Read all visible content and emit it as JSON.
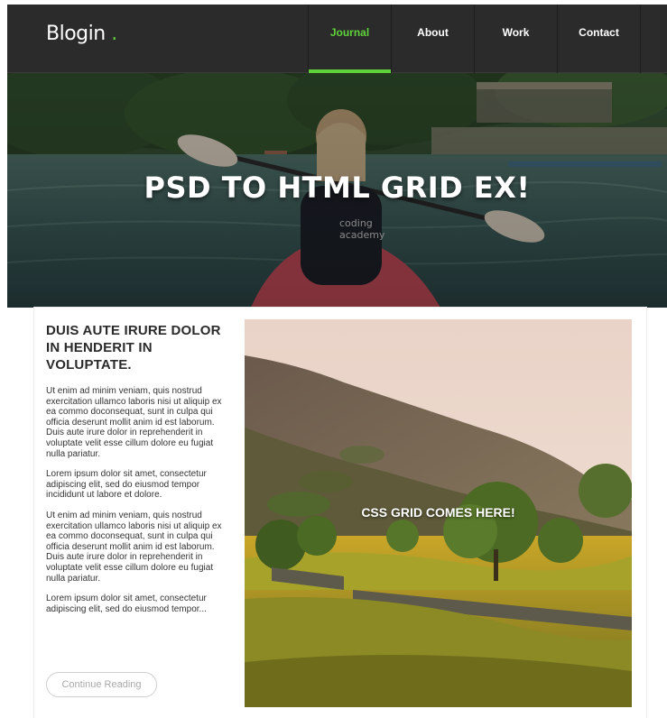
{
  "header": {
    "logo_text": "Blogin",
    "logo_dot": ".",
    "nav": [
      {
        "label": "Journal",
        "active": true
      },
      {
        "label": "About",
        "active": false
      },
      {
        "label": "Work",
        "active": false
      },
      {
        "label": "Contact",
        "active": false
      }
    ]
  },
  "hero": {
    "title": "PSD TO HTML GRID EX!",
    "shirt_text": [
      "coding",
      "academy"
    ]
  },
  "article": {
    "title": "DUIS AUTE IRURE DOLOR IN HENDERIT IN VOLUPTATE.",
    "paragraphs": [
      "Ut enim ad minim veniam, quis nostrud exercitation ullamco laboris nisi ut aliquip ex ea commo doconsequat, sunt in culpa qui officia deserunt mollit anim id est laborum. Duis aute irure dolor in reprehenderit in voluptate velit esse cillum dolore eu fugiat nulla pariatur.",
      "Lorem ipsum dolor sit amet, consectetur adipiscing elit, sed do eiusmod tempor incididunt ut labore et dolore.",
      "Ut enim ad minim veniam, quis nostrud exercitation ullamco laboris nisi ut aliquip ex ea commo doconsequat, sunt in culpa qui officia deserunt mollit anim id est laborum. Duis aute irure dolor in reprehenderit in voluptate velit esse cillum dolore eu fugiat nulla pariatur.",
      "Lorem ipsum dolor sit amet, consectetur adipiscing elit, sed do eiusmod tempor..."
    ],
    "button_label": "Continue Reading"
  },
  "feature": {
    "caption": "CSS GRID COMES HERE!"
  },
  "colors": {
    "accent": "#5fd13a",
    "header_bg": "#2b2b2b"
  }
}
